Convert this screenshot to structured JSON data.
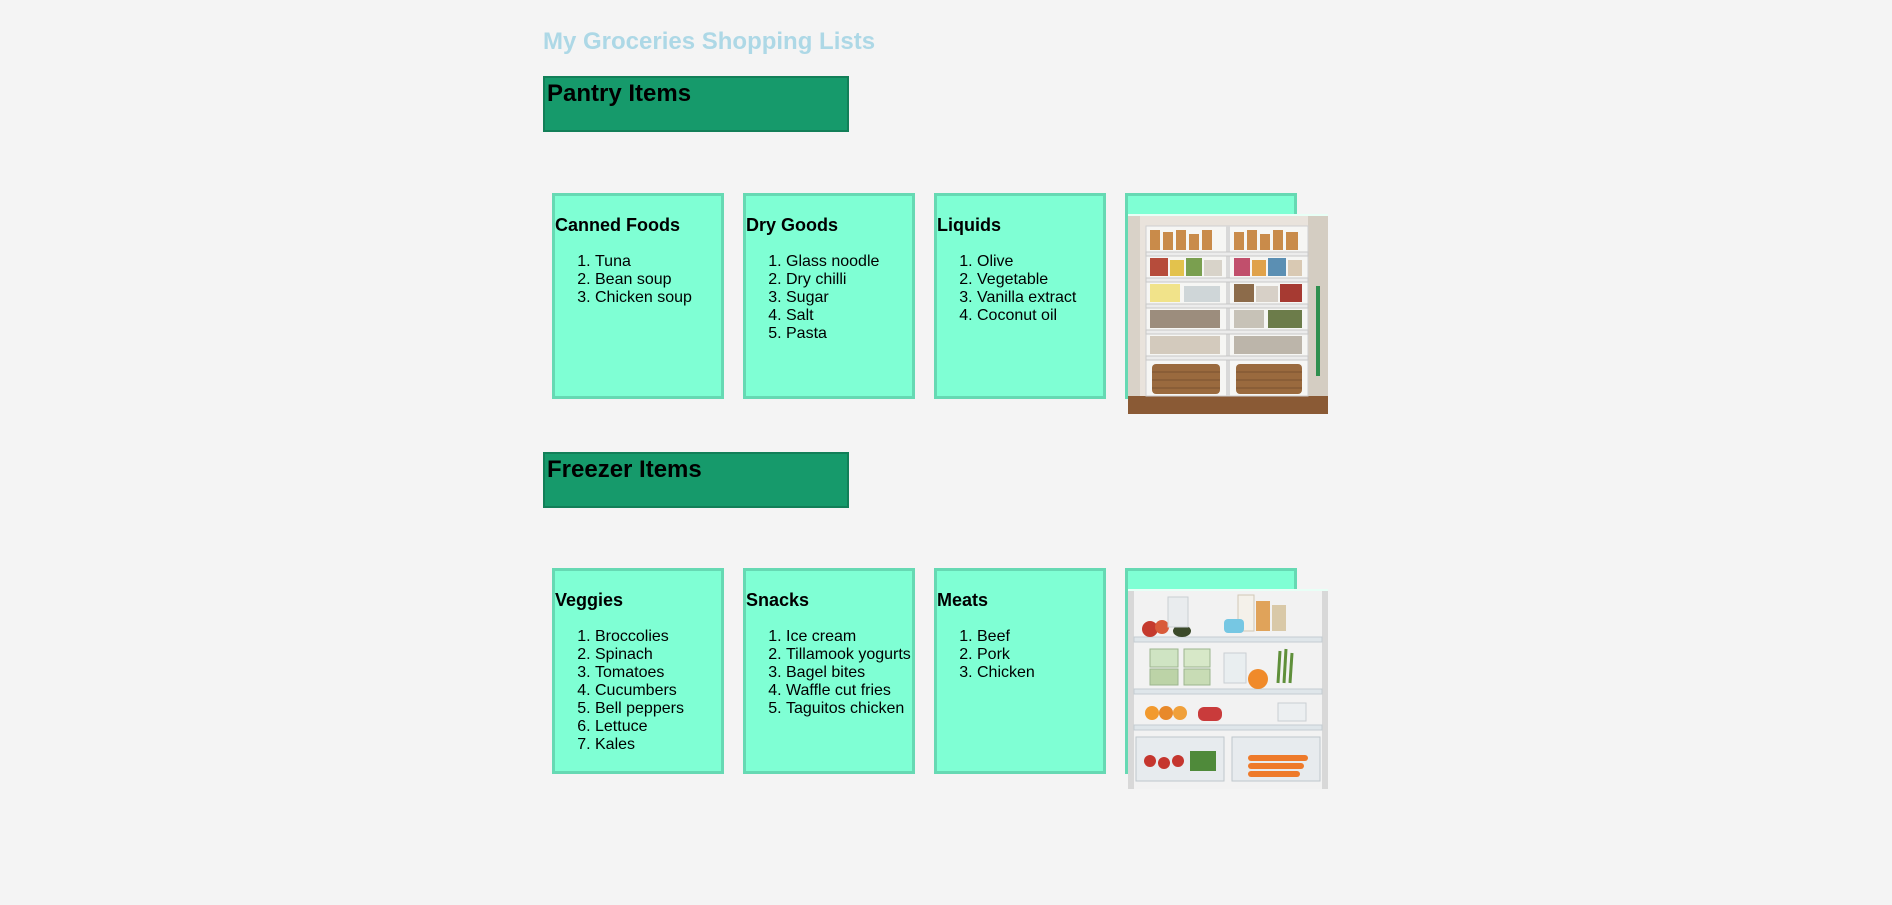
{
  "page": {
    "title": "My Groceries Shopping Lists"
  },
  "sections": [
    {
      "title": "Pantry Items",
      "cards": [
        {
          "title": "Canned Foods",
          "items": [
            "Tuna",
            "Bean soup",
            "Chicken soup"
          ]
        },
        {
          "title": "Dry Goods",
          "items": [
            "Glass noodle",
            "Dry chilli",
            "Sugar",
            "Salt",
            "Pasta"
          ]
        },
        {
          "title": "Liquids",
          "items": [
            "Olive",
            "Vegetable",
            "Vanilla extract",
            "Coconut oil"
          ]
        }
      ],
      "photo_icon": "pantry-shelves-photo"
    },
    {
      "title": "Freezer Items",
      "cards": [
        {
          "title": "Veggies",
          "items": [
            "Broccolies",
            "Spinach",
            "Tomatoes",
            "Cucumbers",
            "Bell peppers",
            "Lettuce",
            "Kales"
          ]
        },
        {
          "title": "Snacks",
          "items": [
            "Ice cream",
            "Tillamook yogurts",
            "Bagel bites",
            "Waffle cut fries",
            "Taguitos chicken"
          ]
        },
        {
          "title": "Meats",
          "items": [
            "Beef",
            "Pork",
            "Chicken"
          ]
        }
      ],
      "photo_icon": "fridge-contents-photo"
    }
  ],
  "colors": {
    "title": "#add8e6",
    "section_header_bg": "#169a6b",
    "card_bg": "#7fffd4",
    "card_border": "#66d9b3",
    "page_bg": "#f4f4f4"
  }
}
